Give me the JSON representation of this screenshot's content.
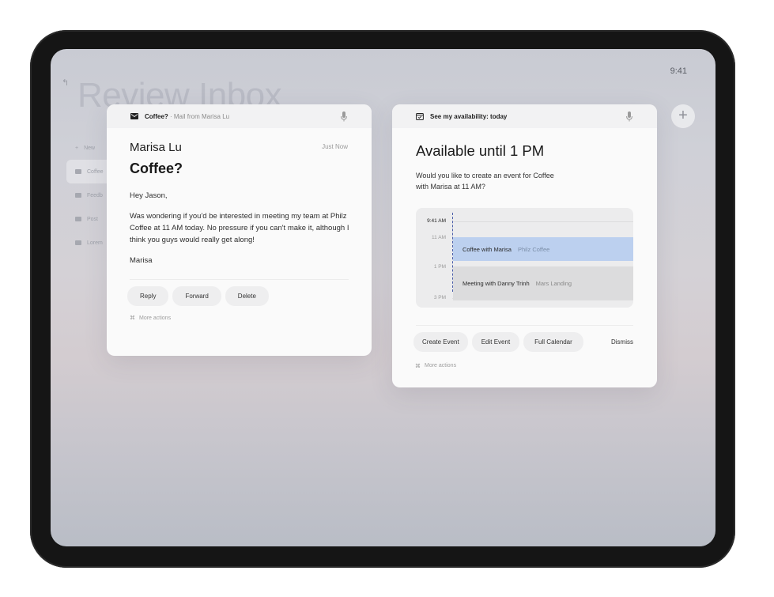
{
  "status": {
    "time": "9:41"
  },
  "background": {
    "back_icon": "return-arrow-icon",
    "title": "Review Inbox",
    "sidebar": [
      {
        "label": "New",
        "icon": "plus-icon"
      },
      {
        "label": "Coffee",
        "icon": "mail-icon",
        "active": true
      },
      {
        "label": "Feedb",
        "icon": "mail-icon"
      },
      {
        "label": "Post",
        "icon": "mail-icon"
      },
      {
        "label": "Lorem",
        "icon": "mail-icon"
      }
    ],
    "add_icon": "plus-icon"
  },
  "mail_card": {
    "header_title": "Coffee?",
    "header_sub": " · Mail from Marisa Lu",
    "icon": "mail-icon",
    "mic_icon": "microphone-icon",
    "sender": "Marisa Lu",
    "time": "Just Now",
    "subject": "Coffee?",
    "greeting": "Hey Jason,",
    "message": "Was wondering if you'd be interested in meeting my team at Philz Coffee at 11 AM today. No pressure if you can't make it, although I think you guys would really get along!",
    "signoff": "Marisa",
    "buttons": {
      "reply": "Reply",
      "forward": "Forward",
      "delete": "Delete"
    },
    "more_actions": "More actions",
    "more_icon": "command-key-icon"
  },
  "availability_card": {
    "header_title": "See my availability: today",
    "icon": "calendar-icon",
    "mic_icon": "microphone-icon",
    "title": "Available until 1 PM",
    "question": "Would you like to create an event for Coffee with Marisa at 11 AM?",
    "calendar": {
      "time_now": "9:41 AM",
      "time_11": "11 AM",
      "time_1": "1 PM",
      "time_3": "3 PM",
      "events": [
        {
          "title": "Coffee with Marisa",
          "location": "Philz Coffee",
          "color": "#bcd0ef"
        },
        {
          "title": "Meeting with Danny Trinh",
          "location": "Mars Landing",
          "color": "#dcdcdd"
        }
      ]
    },
    "buttons": {
      "create": "Create Event",
      "edit": "Edit Event",
      "full": "Full Calendar",
      "dismiss": "Dismiss"
    },
    "more_actions": "More actions",
    "more_icon": "command-key-icon"
  }
}
